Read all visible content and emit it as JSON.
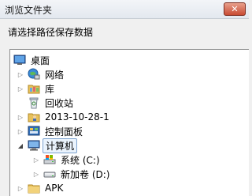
{
  "window": {
    "title": "浏览文件夹",
    "close_label": "✕"
  },
  "prompt": "请选择路径保存数据",
  "tree": {
    "items": [
      {
        "label": "桌面",
        "icon": "desktop-icon"
      },
      {
        "label": "网络",
        "icon": "network-icon",
        "expander": "collapsed"
      },
      {
        "label": "库",
        "icon": "library-icon",
        "expander": "collapsed"
      },
      {
        "label": "回收站",
        "icon": "recycle-bin-icon"
      },
      {
        "label": "2013-10-28-1",
        "icon": "user-folder-icon",
        "expander": "collapsed"
      },
      {
        "label": "控制面板",
        "icon": "control-panel-icon",
        "expander": "collapsed"
      },
      {
        "label": "计算机",
        "icon": "computer-icon",
        "expander": "expanded",
        "selected": true
      },
      {
        "label": "系统 (C:)",
        "icon": "system-drive-icon",
        "expander": "collapsed"
      },
      {
        "label": "新加卷 (D:)",
        "icon": "drive-icon",
        "expander": "collapsed"
      },
      {
        "label": "APK",
        "icon": "folder-icon",
        "expander": "collapsed"
      }
    ]
  },
  "colors": {
    "selection_border": "#7da2ce",
    "selection_fill": "#eaf3fd",
    "close_button": "#c94b33"
  }
}
